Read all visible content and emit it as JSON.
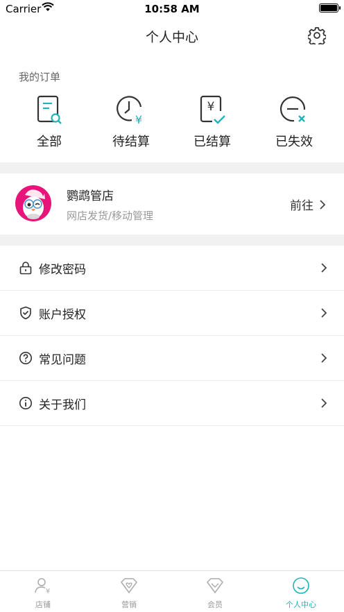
{
  "status": {
    "carrier": "Carrier",
    "time": "10:58 AM"
  },
  "nav": {
    "title": "个人中心"
  },
  "orders": {
    "title": "我的订单",
    "items": [
      {
        "label": "全部",
        "icon": "document-search-icon"
      },
      {
        "label": "待结算",
        "icon": "clock-yen-icon"
      },
      {
        "label": "已结算",
        "icon": "document-yen-check-icon"
      },
      {
        "label": "已失效",
        "icon": "minus-circle-x-icon"
      }
    ]
  },
  "shop": {
    "name": "鹦鹉管店",
    "desc": "网店发货/移动管理",
    "action": "前往"
  },
  "menu": {
    "items": [
      {
        "label": "修改密码",
        "icon": "lock-icon"
      },
      {
        "label": "账户授权",
        "icon": "shield-check-icon"
      },
      {
        "label": "常见问题",
        "icon": "question-circle-icon"
      },
      {
        "label": "关于我们",
        "icon": "info-circle-icon"
      }
    ]
  },
  "tabs": {
    "items": [
      {
        "label": "店铺",
        "icon": "person-yen-icon"
      },
      {
        "label": "营销",
        "icon": "diamond-heart-icon"
      },
      {
        "label": "会员",
        "icon": "diamond-icon"
      },
      {
        "label": "个人中心",
        "icon": "smile-icon"
      }
    ],
    "active": "个人中心"
  },
  "colors": {
    "accent": "#1fb3b8",
    "brand_pink": "#e7157a",
    "divider": "#f1f1f1"
  }
}
